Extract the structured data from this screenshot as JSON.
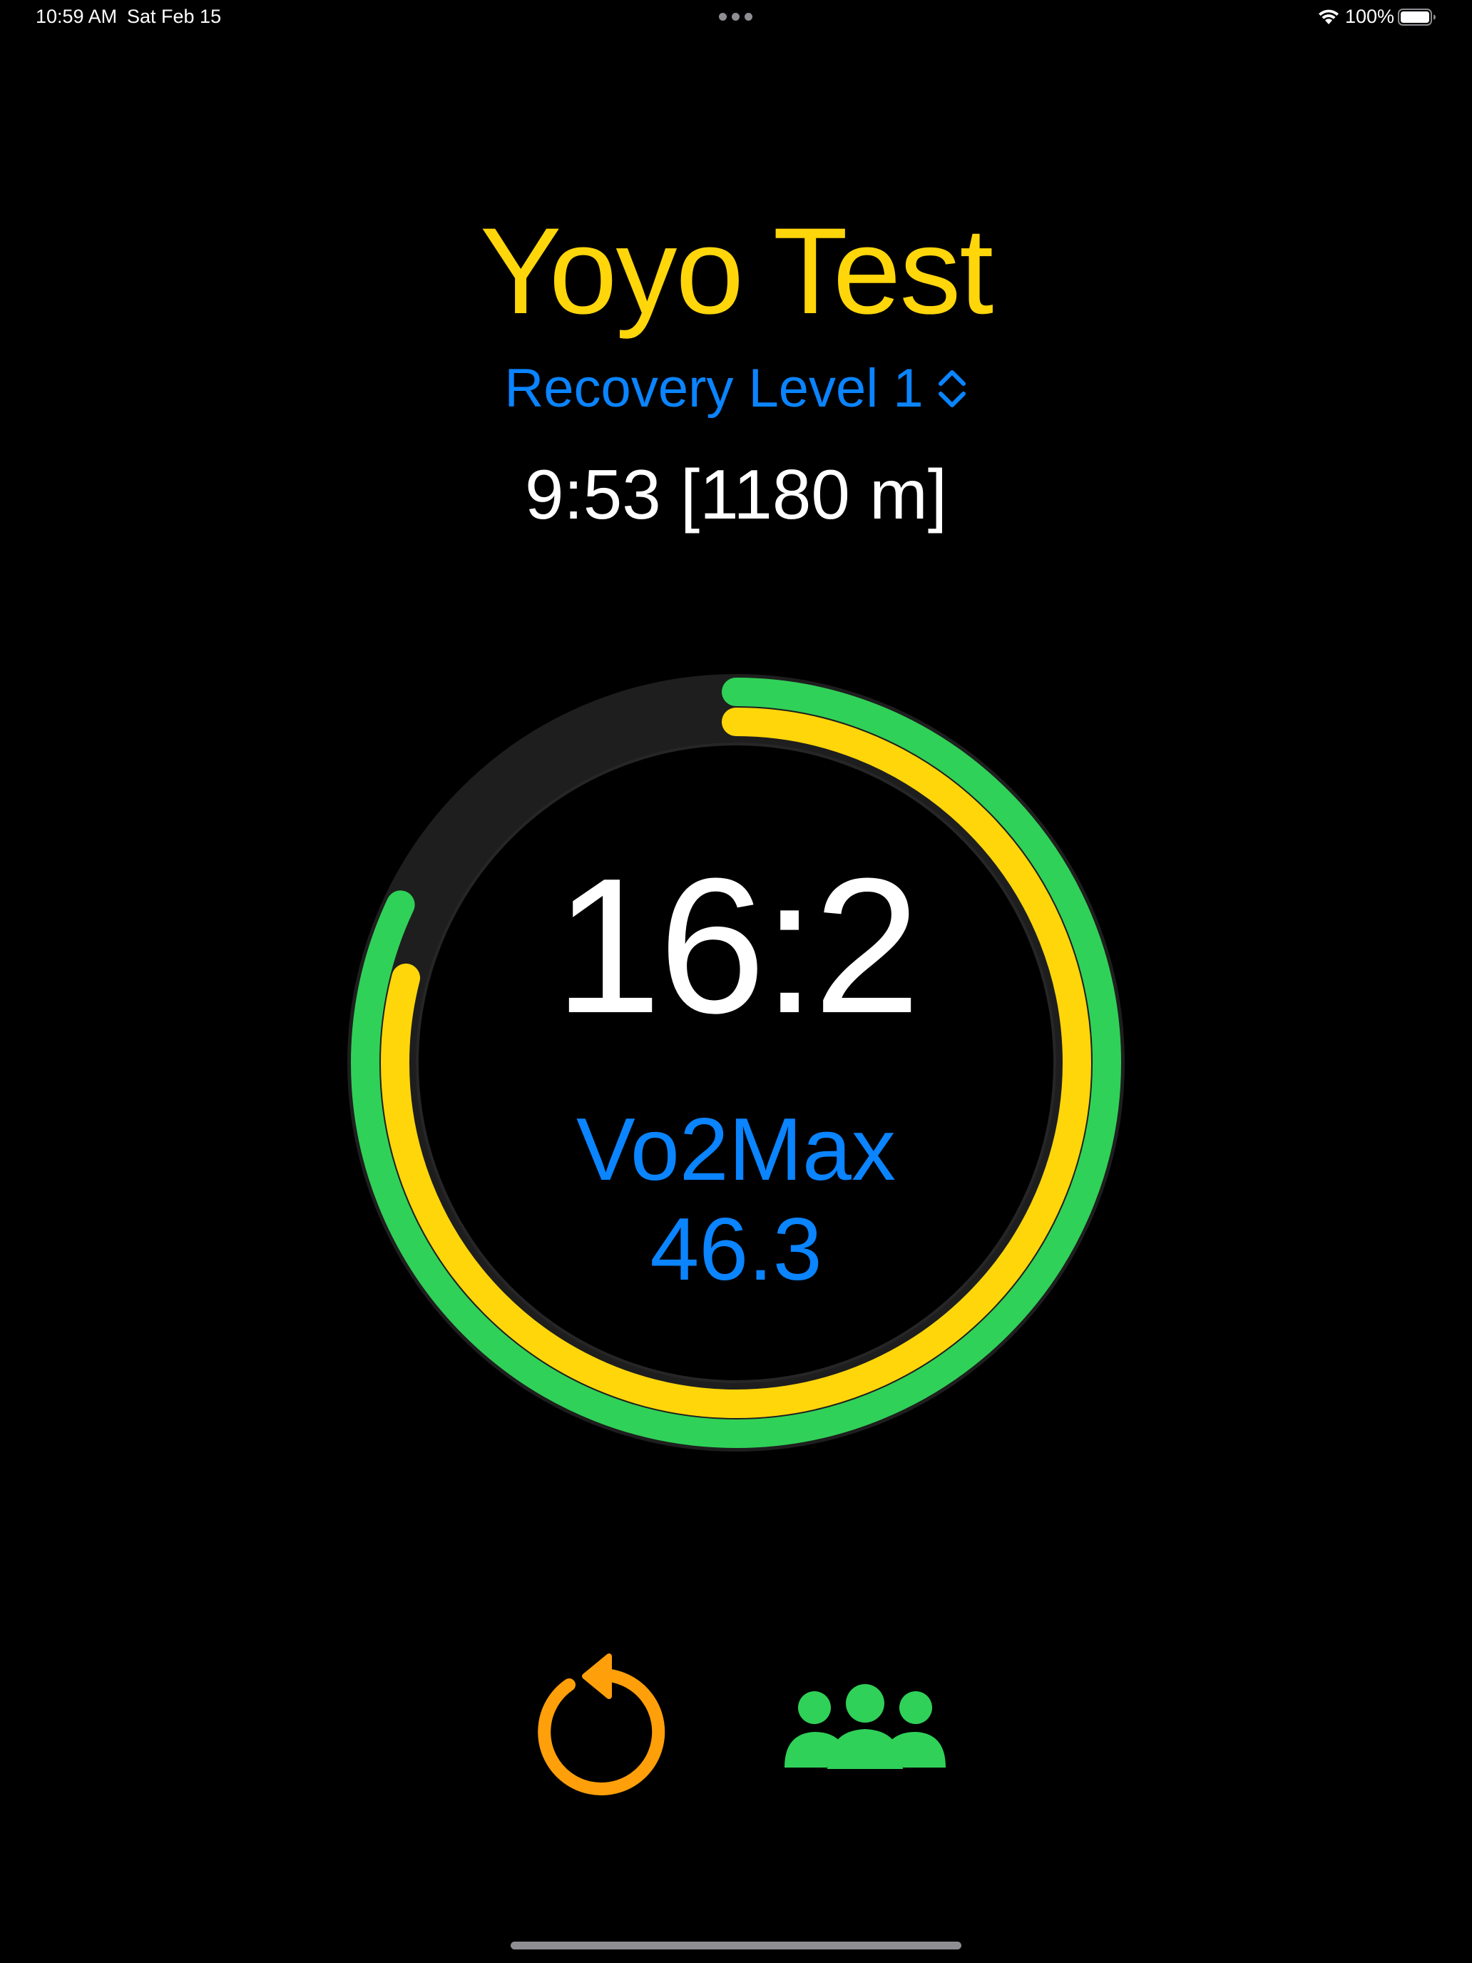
{
  "status_bar": {
    "time": "10:59 AM",
    "date": "Sat Feb 15",
    "battery_percent": "100%",
    "icons": [
      "wifi-icon",
      "battery-icon",
      "multitasking-dots-icon"
    ]
  },
  "header": {
    "title": "Yoyo Test",
    "level_selector": "Recovery Level 1",
    "level_detail": "9:53 [1180 m]"
  },
  "ring": {
    "stage": "16:2",
    "vo2_label": "Vo2Max",
    "vo2_value": "46.3",
    "outer_progress": 0.82,
    "inner_progress": 0.79
  },
  "controls": {
    "reset_icon": "arrow-counterclockwise-circle-icon",
    "group_icon": "person-3-fill-icon"
  },
  "colors": {
    "title": "#ffd60a",
    "accent_blue": "#0a84ff",
    "ring_outer": "#30d158",
    "ring_inner": "#ffd60a",
    "ring_track": "#1e1e1e",
    "reset_orange": "#ff9f0a",
    "group_green": "#30d158",
    "background": "#000000"
  }
}
